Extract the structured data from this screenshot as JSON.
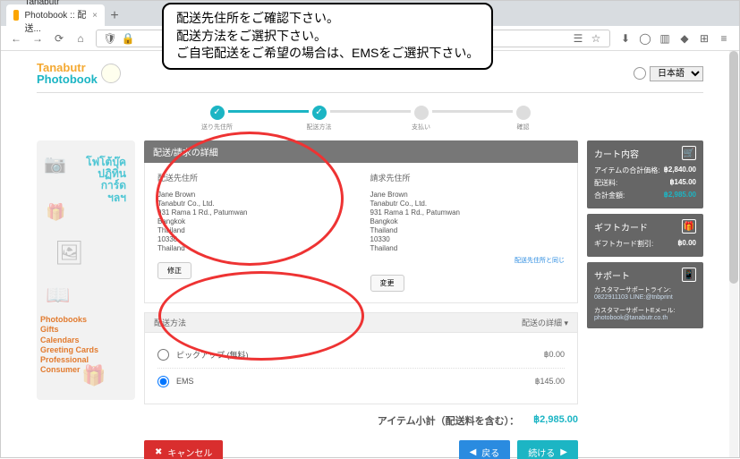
{
  "browser": {
    "tab_title": "Tanabutr Photobook :: 配送...",
    "url": ""
  },
  "callout": {
    "l1": "配送先住所をご確認下さい。",
    "l2": "配送方法をご選択下さい。",
    "l3": "ご自宅配送をご希望の場合は、EMSをご選択下さい。"
  },
  "logo": {
    "top": "Tanabutr",
    "bottom": "Photobook"
  },
  "language": {
    "label": "日本語"
  },
  "steps": {
    "s1": "送り先住所",
    "s2": "配送方法",
    "s3": "支払い",
    "s4": "確認"
  },
  "sidebar": {
    "thai": {
      "l1": "โฟโต้บุ๊ค",
      "l2": "ปฏิทิน",
      "l3": "การ์ด",
      "l4": "ฯลฯ"
    },
    "links": [
      "Photobooks",
      "Gifts",
      "Calendars",
      "Greeting Cards",
      "Professional",
      "Consumer"
    ]
  },
  "addr_panel": {
    "head": "配送/請求の詳細",
    "ship_title": "配送先住所",
    "bill_title": "請求先住所",
    "name": "Jane Brown",
    "company": "Tanabutr Co., Ltd.",
    "street": "931 Rama 1 Rd., Patumwan",
    "city": "Bangkok",
    "country1": "Thailand",
    "zip": "10330",
    "country2": "Thailand",
    "same_link": "配送先住所と同じ",
    "btn_fix": "修正",
    "btn_edit": "変更"
  },
  "shipping": {
    "head_label": "配送方法",
    "head_right": "配送の詳細",
    "opt_pickup": "ピックアップ (無料)",
    "price_pickup": "฿0.00",
    "opt_ems": "EMS",
    "price_ems": "฿145.00"
  },
  "subtotal": {
    "label": "アイテム小計（配送料を含む）：",
    "value": "฿2,985.00"
  },
  "actions": {
    "cancel": "キャンセル",
    "back": "戻る",
    "next": "続ける"
  },
  "summary": {
    "cart_h": "カート内容",
    "row1_l": "アイテムの合計価格:",
    "row1_v": "฿2,840.00",
    "row2_l": "配送料:",
    "row2_v": "฿145.00",
    "row3_l": "合計金額:",
    "row3_v": "฿2,985.00",
    "gift_h": "ギフトカード",
    "gift_l": "ギフトカード割引:",
    "gift_v": "฿0.00",
    "support_h": "サポート",
    "support_l1": "カスタマーサポートライン:",
    "support_v1": "0822911103 LINE:@tnbprint",
    "support_l2": "カスタマーサポートEメール:",
    "support_v2": "photobook@tanabutr.co.th"
  }
}
